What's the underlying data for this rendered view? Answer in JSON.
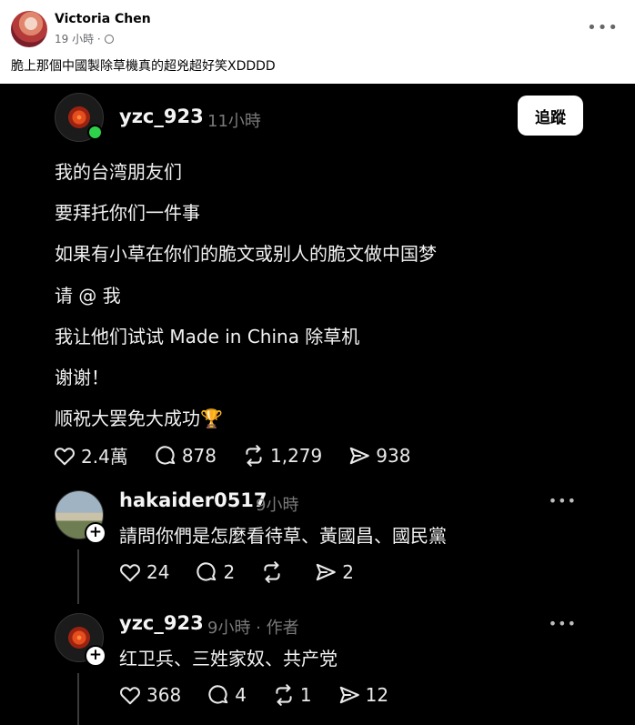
{
  "facebook": {
    "author": "Victoria Chen",
    "time": "19 小時 ·",
    "caption": "脆上那個中國製除草機真的超兇超好笑XDDDD",
    "more_label": "•••"
  },
  "threads_post": {
    "username": "yzc_923",
    "time": "11小時",
    "follow_label": "追蹤",
    "lines": [
      "我的台湾朋友们",
      "要拜托你们一件事",
      "如果有小草在你们的脆文或别人的脆文做中国梦",
      "请 @ 我",
      "我让他们试试 Made in China 除草机",
      "谢谢！",
      "顺祝大罢免大成功🏆"
    ],
    "likes": "2.4萬",
    "comments": "878",
    "reposts": "1,279",
    "shares": "938"
  },
  "replies": [
    {
      "username": "hakaider0517",
      "time": "9小時",
      "text": "請問你們是怎麼看待草、黃國昌、國民黨",
      "likes": "24",
      "comments": "2",
      "reposts": "",
      "shares": "2"
    },
    {
      "username": "yzc_923",
      "time": "9小時 · 作者",
      "text": "红卫兵、三姓家奴、共产党",
      "likes": "368",
      "comments": "4",
      "reposts": "1",
      "shares": "12"
    }
  ],
  "icons": {
    "like": "heart-icon",
    "comment": "comment-icon",
    "repost": "repost-icon",
    "share": "share-icon"
  },
  "colors": {
    "threads_bg": "#000000",
    "online": "#2fd04a",
    "muted": "#7a7a7a"
  }
}
